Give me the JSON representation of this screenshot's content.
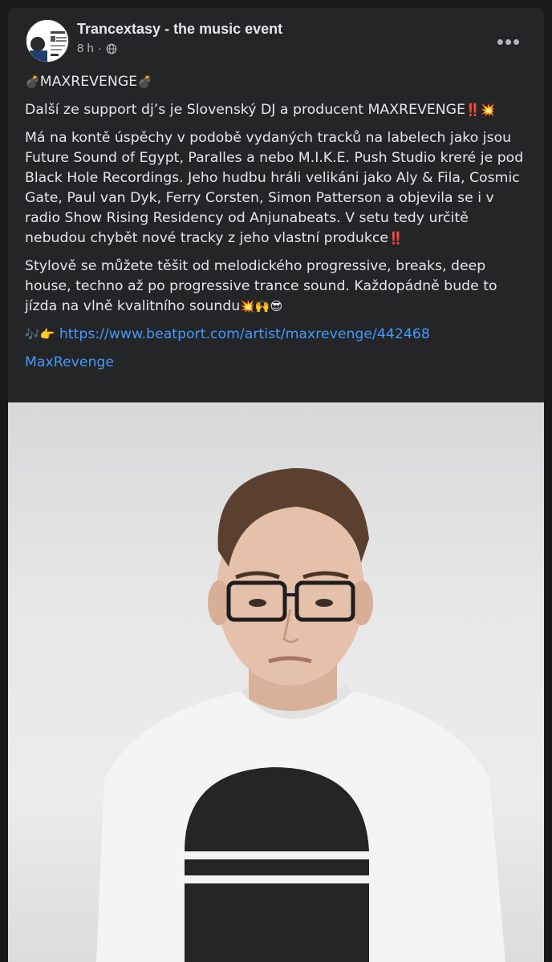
{
  "post": {
    "page_name": "Trancextasy - the music event",
    "time": "8 h",
    "more_label": "•••",
    "title": "MAXREVENGE",
    "title_emoji": "💣",
    "paragraph1": "Další ze support dj’s je Slovenský DJ a producent MAXREVENGE",
    "paragraph1_emoji": "‼️💥",
    "paragraph2": "Má na kontě úspěchy v podobě vydaných tracků na labelech jako jsou Future Sound of Egypt, Paralles a nebo M.I.K.E. Push Studio kreré je pod Black Hole Recordings. Jeho hudbu hráli velikáni jako Aly & Fila, Cosmic Gate, Paul van Dyk, Ferry Corsten, Simon Patterson a objevila se i v radio Show Rising Residency od Anjunabeats. V setu tedy určitě nebudou chybět nové tracky z jeho vlastní produkce",
    "paragraph2_emoji": "‼️",
    "paragraph3": "Stylově se můžete těšit od melodického progressive, breaks, deep house, techno až po progressive trance sound. Každopádně bude to jízda na vlně kvalitního soundu",
    "paragraph3_emoji": "💥🙌😎",
    "link_emoji": "🎶👉",
    "link_url": "https://www.beatport.com/artist/maxrevenge/442468",
    "hashtag": "MaxRevenge"
  },
  "icons": {
    "globe": "globe-icon",
    "more": "more-options-icon"
  },
  "colors": {
    "background": "#18191a",
    "card": "#242526",
    "text": "#e4e6eb",
    "secondary_text": "#b0b3b8",
    "link": "#4599ff"
  }
}
